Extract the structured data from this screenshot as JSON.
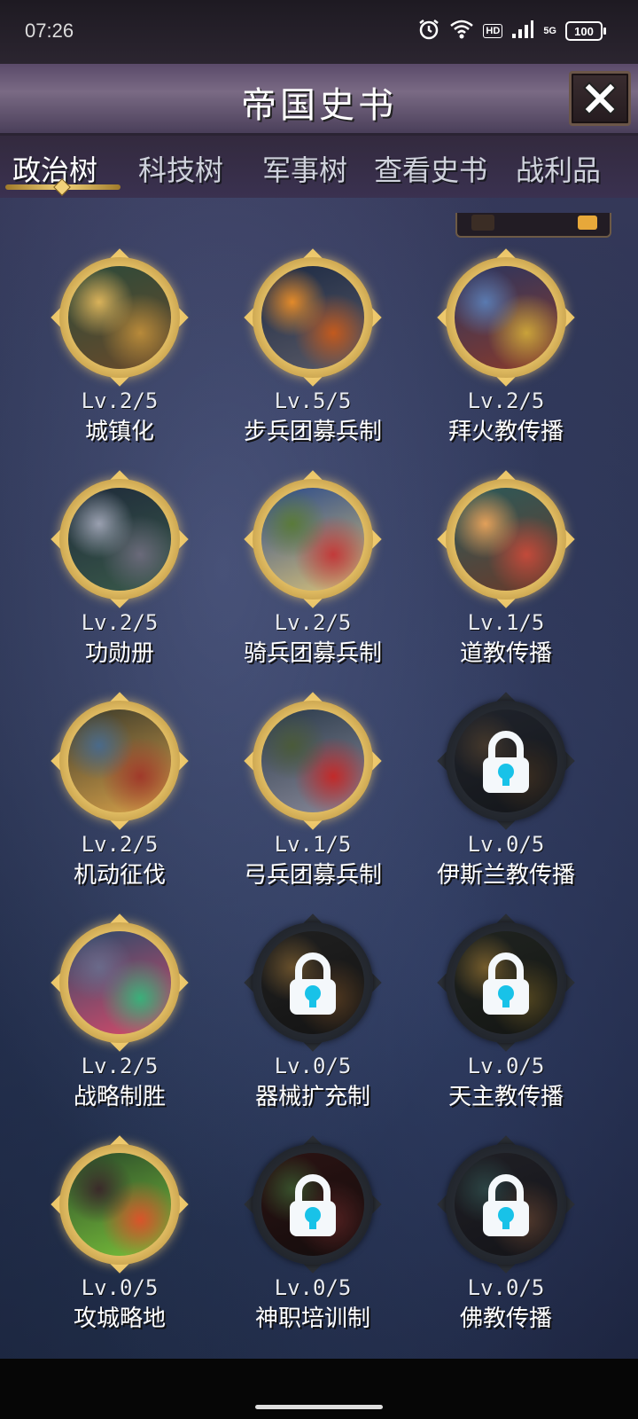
{
  "status_bar": {
    "time": "07:26",
    "network": "5G",
    "hd": "HD",
    "battery": "100"
  },
  "header": {
    "title": "帝国史书",
    "close_icon": "close-icon"
  },
  "tabs": [
    {
      "label": "政治树",
      "active": true
    },
    {
      "label": "科技树",
      "active": false
    },
    {
      "label": "军事树",
      "active": false
    },
    {
      "label": "查看史书",
      "active": false
    },
    {
      "label": "战利品",
      "active": false
    }
  ],
  "nodes": [
    {
      "level": "Lv.2/5",
      "name": "城镇化",
      "locked": false,
      "art_colors": [
        "#2b4a3a",
        "#b88a3a",
        "#6a4a2a",
        "#d9b25a"
      ]
    },
    {
      "level": "Lv.5/5",
      "name": "步兵团募兵制",
      "locked": false,
      "art_colors": [
        "#1c2a44",
        "#c25a1e",
        "#5a5a66",
        "#e28a2a"
      ]
    },
    {
      "level": "Lv.2/5",
      "name": "拜火教传播",
      "locked": false,
      "art_colors": [
        "#2a3560",
        "#c9a23a",
        "#8a3a2a",
        "#5a7ab0"
      ]
    },
    {
      "level": "Lv.2/5",
      "name": "功勋册",
      "locked": false,
      "art_colors": [
        "#1e2a3a",
        "#6a6a7a",
        "#3a5a4a",
        "#9aa0b0"
      ]
    },
    {
      "level": "Lv.2/5",
      "name": "骑兵团募兵制",
      "locked": false,
      "art_colors": [
        "#2a4a8a",
        "#c23a3a",
        "#d9c27a",
        "#5a7a3a"
      ]
    },
    {
      "level": "Lv.1/5",
      "name": "道教传播",
      "locked": false,
      "art_colors": [
        "#2a5a5a",
        "#c24a3a",
        "#6a3a2a",
        "#e2a05a"
      ]
    },
    {
      "level": "Lv.2/5",
      "name": "机动征伐",
      "locked": false,
      "art_colors": [
        "#3a3a2a",
        "#a03a2a",
        "#d9a24a",
        "#4a6a8a"
      ]
    },
    {
      "level": "Lv.1/5",
      "name": "弓兵团募兵制",
      "locked": false,
      "art_colors": [
        "#2a3a4a",
        "#c22a2a",
        "#8a8a9a",
        "#4a5a3a"
      ]
    },
    {
      "level": "Lv.0/5",
      "name": "伊斯兰教传播",
      "locked": true,
      "art_colors": [
        "#2a2f3a",
        "#4a3a2a",
        "#1a1d22",
        "#5a4a3a"
      ]
    },
    {
      "level": "Lv.2/5",
      "name": "战略制胜",
      "locked": false,
      "art_colors": [
        "#2a4a6a",
        "#3ab07a",
        "#d94a6a",
        "#6a6a8a"
      ]
    },
    {
      "level": "Lv.0/5",
      "name": "器械扩充制",
      "locked": true,
      "art_colors": [
        "#2a2a2a",
        "#6a4a2a",
        "#1a1a1a",
        "#8a6a3a"
      ]
    },
    {
      "level": "Lv.0/5",
      "name": "天主教传播",
      "locked": true,
      "art_colors": [
        "#2a2f2a",
        "#6a5a2a",
        "#1a1d1a",
        "#9a7a3a"
      ]
    },
    {
      "level": "Lv.0/5",
      "name": "攻城略地",
      "locked": false,
      "art_colors": [
        "#2a4a2a",
        "#d9542a",
        "#7ac23a",
        "#3a2a2a"
      ]
    },
    {
      "level": "Lv.0/5",
      "name": "神职培训制",
      "locked": true,
      "art_colors": [
        "#3a1a1a",
        "#6a2a2a",
        "#1a1010",
        "#4a6a3a"
      ]
    },
    {
      "level": "Lv.0/5",
      "name": "佛教传播",
      "locked": true,
      "art_colors": [
        "#2a2a32",
        "#6a4a3a",
        "#1a1a20",
        "#3a5a5a"
      ]
    }
  ],
  "icons": {
    "lock": "lock-icon",
    "alarm": "alarm-icon",
    "wifi": "wifi-icon",
    "signal": "signal-icon"
  },
  "colors": {
    "gold_frame": "#e9c56a",
    "lock_blue": "#18c2e8",
    "tab_underline": "#f2d27a"
  }
}
